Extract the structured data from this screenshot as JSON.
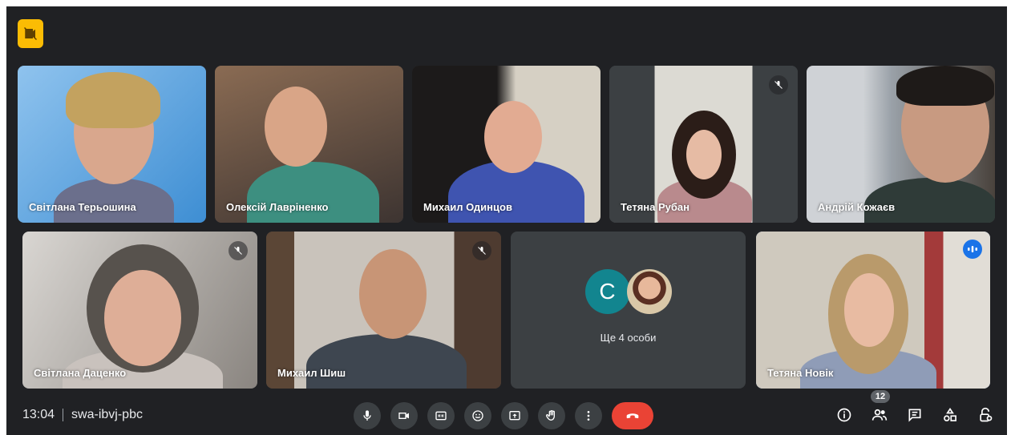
{
  "participants": [
    {
      "name": "Світлана Терьошина"
    },
    {
      "name": "Олексій Лавріненко"
    },
    {
      "name": "Михаил Одинцов"
    },
    {
      "name": "Тетяна Рубан"
    },
    {
      "name": "Андрій Кожаєв"
    },
    {
      "name": "Світлана Даценко"
    },
    {
      "name": "Михаил Шиш"
    },
    {
      "name": "Тетяна Новік"
    }
  ],
  "others": {
    "avatar_letter": "С",
    "label": "Ще 4 особи"
  },
  "meeting": {
    "time": "13:04",
    "code": "swa-ibvj-pbc",
    "participant_count": "12"
  },
  "icons": {
    "recording": "recording-off-icon",
    "controls": [
      "mic-icon",
      "camera-icon",
      "captions-icon",
      "emoji-icon",
      "present-icon",
      "raise-hand-icon",
      "more-icon",
      "end-call-icon"
    ],
    "right": [
      "info-icon",
      "people-icon",
      "chat-icon",
      "activities-icon",
      "host-controls-icon"
    ]
  },
  "colors": {
    "background": "#202124",
    "tile": "#3c4043",
    "end_call": "#ea4335",
    "active_speaker": "#8ab4f8",
    "recording_badge": "#fbbc04",
    "speaking": "#1a73e8"
  }
}
